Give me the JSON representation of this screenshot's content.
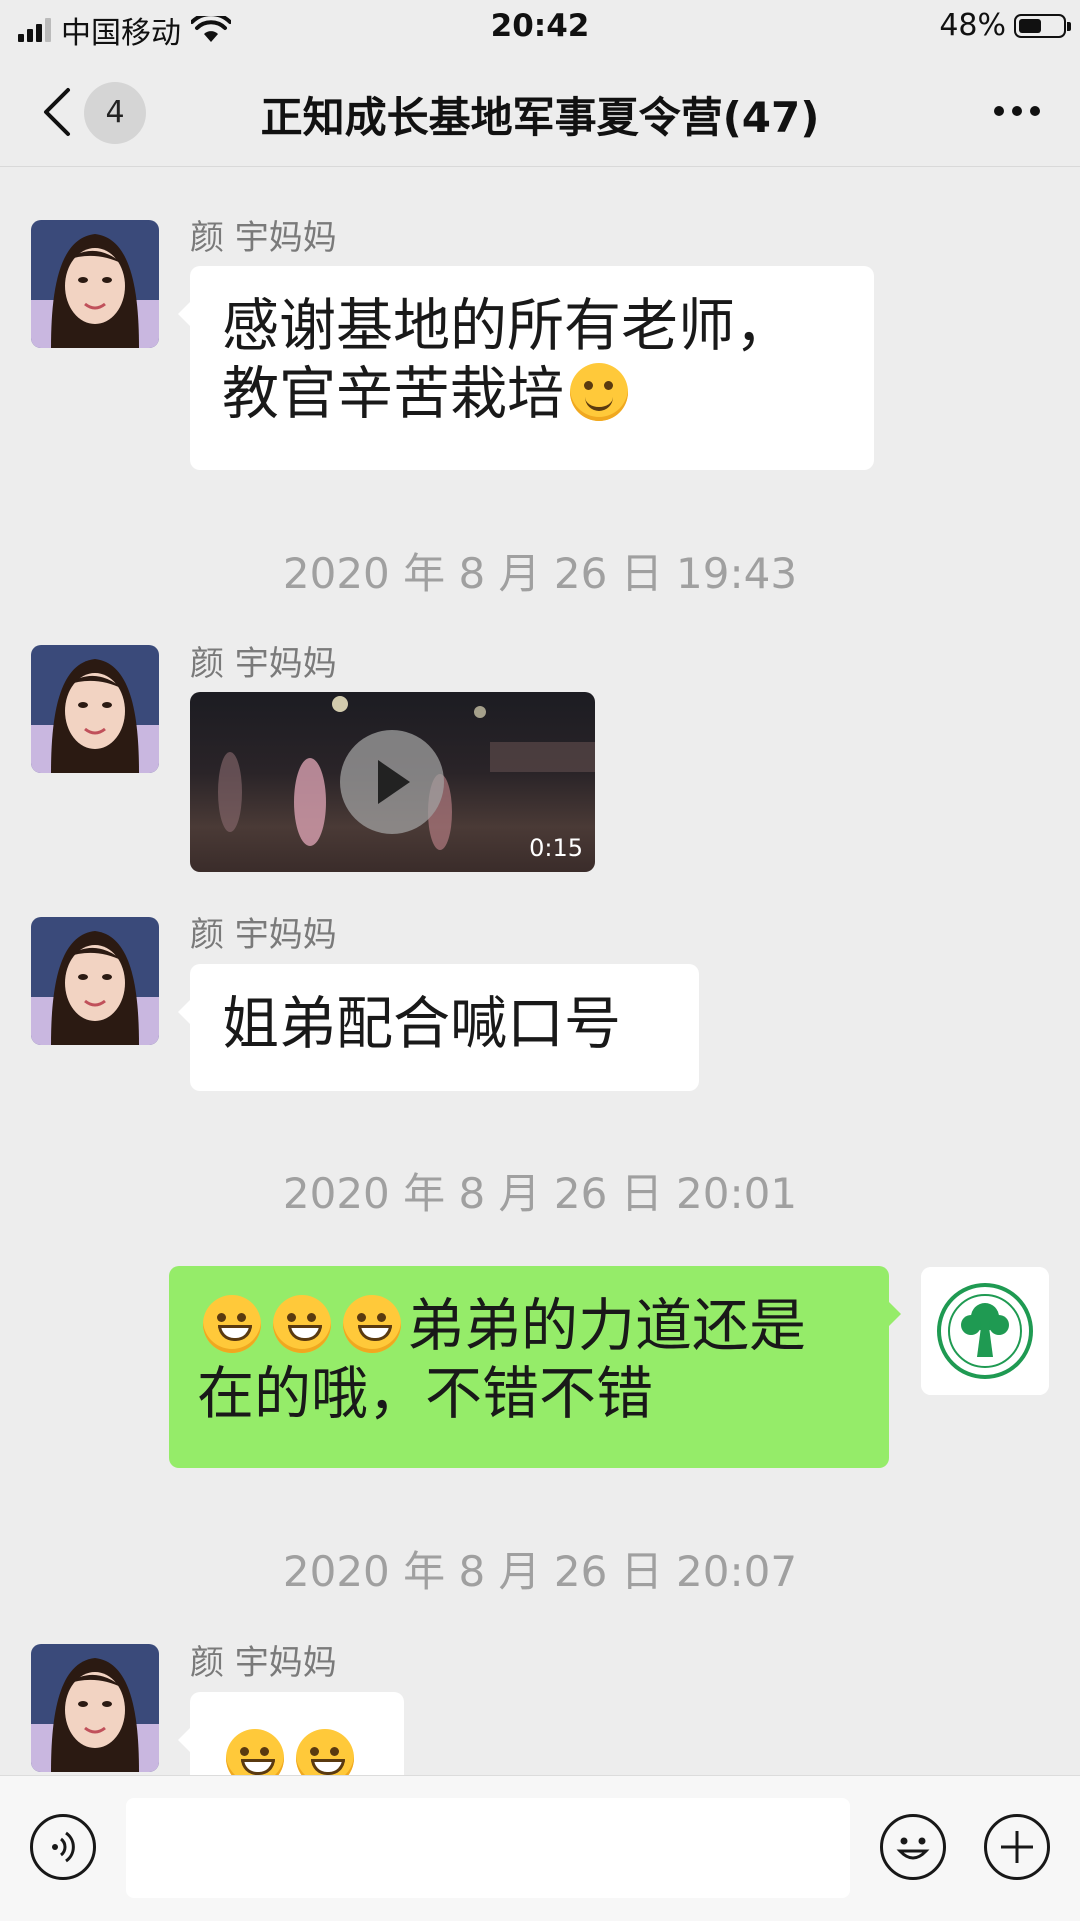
{
  "status_bar": {
    "carrier": "中国移动",
    "time": "20:42",
    "battery": "48%",
    "battery_level": 0.48
  },
  "nav": {
    "back_count": "4",
    "title": "正知成长基地军事夏令营(47)"
  },
  "messages": [
    {
      "sender": "颜 宇妈妈",
      "text_line1": "感谢基地的所有老师，",
      "text_line2": "教官辛苦栽培"
    },
    {
      "timestamp": "2020 年 8 月 26 日 19:43"
    },
    {
      "sender": "颜 宇妈妈",
      "video_duration": "0:15"
    },
    {
      "sender": "颜 宇妈妈",
      "text": "姐弟配合喊口号"
    },
    {
      "timestamp": "2020 年 8 月 26 日 20:01"
    },
    {
      "from_self": true,
      "text_line1": "弟弟的力道还是",
      "text_line2": "在的哦，不错不错"
    },
    {
      "timestamp": "2020 年 8 月 26 日 20:07"
    },
    {
      "sender": "颜 宇妈妈"
    }
  ],
  "colors": {
    "background": "#ededed",
    "self_bubble": "#95ec69",
    "other_bubble": "#ffffff"
  }
}
